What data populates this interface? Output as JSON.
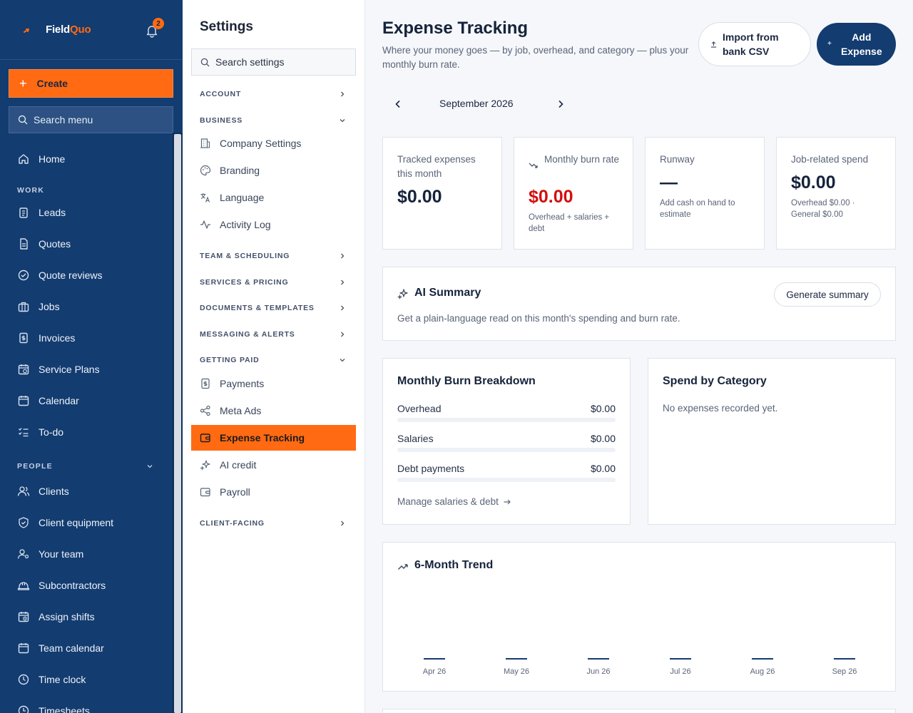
{
  "brand": {
    "name_part1": "Field",
    "name_part2": "Quo",
    "notifications": "2"
  },
  "nav": {
    "create_label": "Create",
    "search_label": "Search menu",
    "home": "Home",
    "section_work": "WORK",
    "work_items": [
      "Leads",
      "Quotes",
      "Quote reviews",
      "Jobs",
      "Invoices",
      "Service Plans",
      "Calendar",
      "To-do"
    ],
    "section_people": "PEOPLE",
    "people_items": [
      "Clients",
      "Client equipment",
      "Your team",
      "Subcontractors",
      "Assign shifts",
      "Team calendar",
      "Time clock",
      "Timesheets"
    ]
  },
  "settings": {
    "title": "Settings",
    "search_placeholder": "Search settings",
    "groups": {
      "account": "ACCOUNT",
      "business": "BUSINESS",
      "team": "TEAM & SCHEDULING",
      "services": "SERVICES & PRICING",
      "documents": "DOCUMENTS & TEMPLATES",
      "messaging": "MESSAGING & ALERTS",
      "getting_paid": "GETTING PAID",
      "client_facing": "CLIENT-FACING"
    },
    "business_items": [
      "Company Settings",
      "Branding",
      "Language",
      "Activity Log"
    ],
    "paid_items": [
      "Payments",
      "Meta Ads",
      "Expense Tracking",
      "AI credit",
      "Payroll"
    ]
  },
  "page": {
    "title": "Expense Tracking",
    "subtitle": "Where your money goes — by job, overhead, and category — plus your monthly burn rate.",
    "import_label_1": "Import from",
    "import_label_2": "bank CSV",
    "add_label_1": "Add",
    "add_label_2": "Expense",
    "month": "September 2026"
  },
  "kpis": {
    "tracked": {
      "label": "Tracked expenses this month",
      "value": "$0.00"
    },
    "burn": {
      "label": "Monthly burn rate",
      "value": "$0.00",
      "note": "Overhead + salaries + debt"
    },
    "runway": {
      "label": "Runway",
      "value": "—",
      "note": "Add cash on hand to estimate"
    },
    "job": {
      "label": "Job-related spend",
      "value": "$0.00",
      "note": "Overhead $0.00 · General $0.00"
    }
  },
  "ai_summary": {
    "title": "AI Summary",
    "description": "Get a plain-language read on this month's spending and burn rate.",
    "button": "Generate summary"
  },
  "burn_breakdown": {
    "title": "Monthly Burn Breakdown",
    "rows": [
      {
        "name": "Overhead",
        "amount": "$0.00",
        "fraction": 0
      },
      {
        "name": "Salaries",
        "amount": "$0.00",
        "fraction": 0
      },
      {
        "name": "Debt payments",
        "amount": "$0.00",
        "fraction": 0
      }
    ],
    "manage_link": "Manage salaries & debt"
  },
  "spend_by_category": {
    "title": "Spend by Category",
    "empty": "No expenses recorded yet."
  },
  "trend": {
    "title": "6-Month Trend",
    "chart_data": {
      "type": "bar",
      "categories": [
        "Apr 26",
        "May 26",
        "Jun 26",
        "Jul 26",
        "Aug 26",
        "Sep 26"
      ],
      "values": [
        0,
        0,
        0,
        0,
        0,
        0
      ],
      "color": "#133c70"
    }
  },
  "colors": {
    "navy": "#133c70",
    "accent": "#ff6a13",
    "negative": "#d30f0f"
  }
}
